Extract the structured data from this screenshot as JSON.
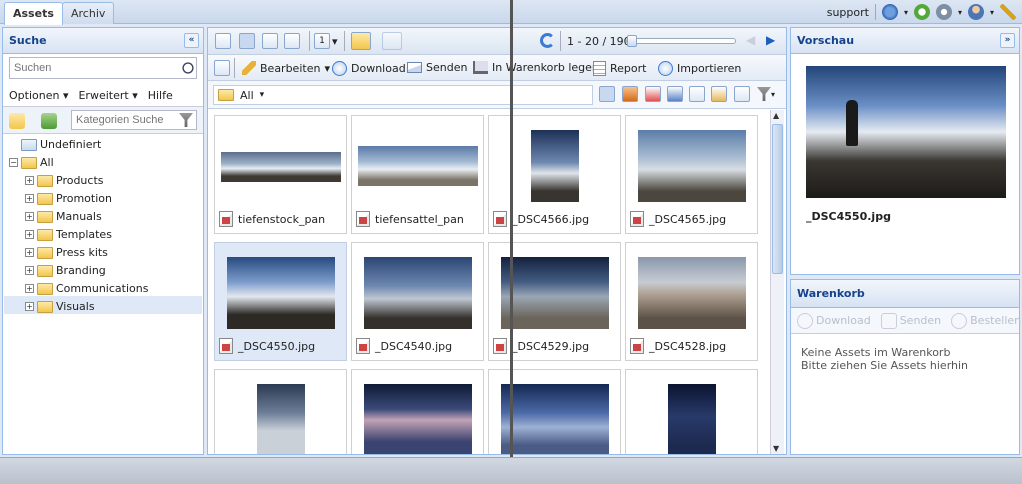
{
  "tabs": {
    "assets": "Assets",
    "archive": "Archiv"
  },
  "user": {
    "name": "support"
  },
  "sidebar": {
    "title": "Suche",
    "search_placeholder": "Suchen",
    "options": "Optionen",
    "advanced": "Erweitert",
    "help": "Hilfe",
    "category_placeholder": "Kategorien Suche",
    "tree": {
      "undefined": "Undefiniert",
      "all": "All",
      "items": [
        "Products",
        "Promotion",
        "Manuals",
        "Templates",
        "Press kits",
        "Branding",
        "Communications",
        "Visuals"
      ]
    }
  },
  "toolbar": {
    "pagination": "1 - 20 / 190",
    "page_count": "1",
    "edit": "Bearbeiten",
    "download": "Download",
    "send": "Senden",
    "cart": "In Warenkorb legen",
    "report": "Report",
    "import": "Importieren",
    "filter": "All"
  },
  "grid": {
    "items": [
      "tiefenstock_pan",
      "tiefensattel_pan",
      "_DSC4566.jpg",
      "_DSC4565.jpg",
      "_DSC4550.jpg",
      "_DSC4540.jpg",
      "_DSC4529.jpg",
      "_DSC4528.jpg",
      "",
      "",
      "",
      ""
    ]
  },
  "preview": {
    "title": "Vorschau",
    "filename": "_DSC4550.jpg"
  },
  "cart": {
    "title": "Warenkorb",
    "download": "Download",
    "send": "Senden",
    "order": "Bestellen",
    "empty1": "Keine Assets im Warenkorb",
    "empty2": "Bitte ziehen Sie Assets hierhin"
  }
}
